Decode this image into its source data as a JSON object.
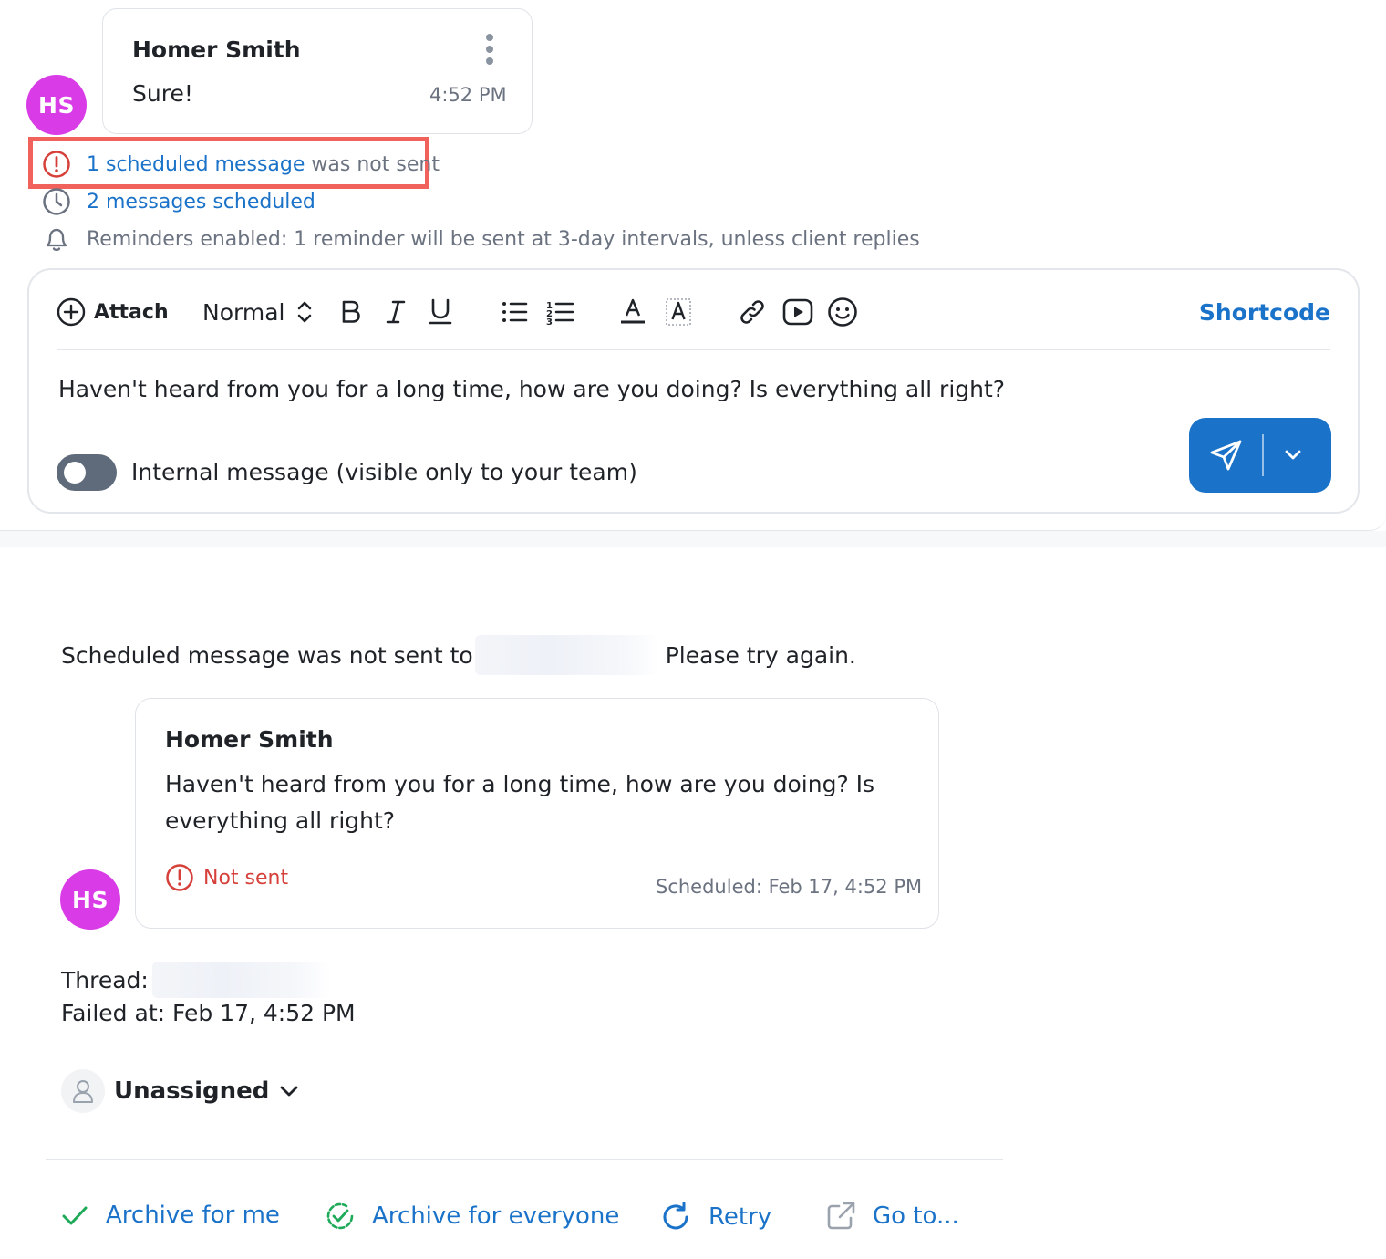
{
  "colors": {
    "accent": "#1a72c9",
    "avatar": "#d93ce6",
    "error": "#d6403a",
    "highlight": "#f2625d",
    "success": "#1faa5a"
  },
  "conversation": {
    "avatar_initials": "HS",
    "last_message": {
      "sender": "Homer Smith",
      "text": "Sure!",
      "time": "4:52 PM"
    },
    "status": {
      "not_sent_link": "1 scheduled message",
      "not_sent_rest": "was not sent",
      "scheduled": "2 messages scheduled",
      "reminders": "Reminders enabled: 1 reminder will be sent at 3-day intervals, unless client replies"
    }
  },
  "composer": {
    "toolbar": {
      "attach_label": "Attach",
      "text_style": "Normal",
      "icons": [
        "plus-circle-icon",
        "updown-chevron-icon",
        "bold-icon",
        "italic-icon",
        "underline-icon",
        "bullet-list-icon",
        "numbered-list-icon",
        "text-color-icon",
        "highlight-color-icon",
        "link-icon",
        "video-icon",
        "emoji-icon"
      ],
      "shortcode_label": "Shortcode"
    },
    "text": "Haven't heard from you for a long time, how are you doing? Is everything all right?",
    "internal_label": "Internal message (visible only to your team)",
    "internal_enabled": false
  },
  "notification": {
    "message_prefix": "Scheduled message was not sent to",
    "message_suffix": "Please try again.",
    "avatar_initials": "HS",
    "card": {
      "sender": "Homer Smith",
      "text": "Haven't heard from you for a long time, how are you doing? Is everything all right?",
      "status": "Not sent",
      "scheduled": "Scheduled: Feb 17, 4:52 PM"
    },
    "thread_label": "Thread:",
    "failed_at": "Failed at: Feb 17, 4:52 PM",
    "assignee": "Unassigned",
    "actions": {
      "archive_me": "Archive for me",
      "archive_everyone": "Archive for everyone",
      "retry": "Retry",
      "go_to": "Go to..."
    }
  }
}
